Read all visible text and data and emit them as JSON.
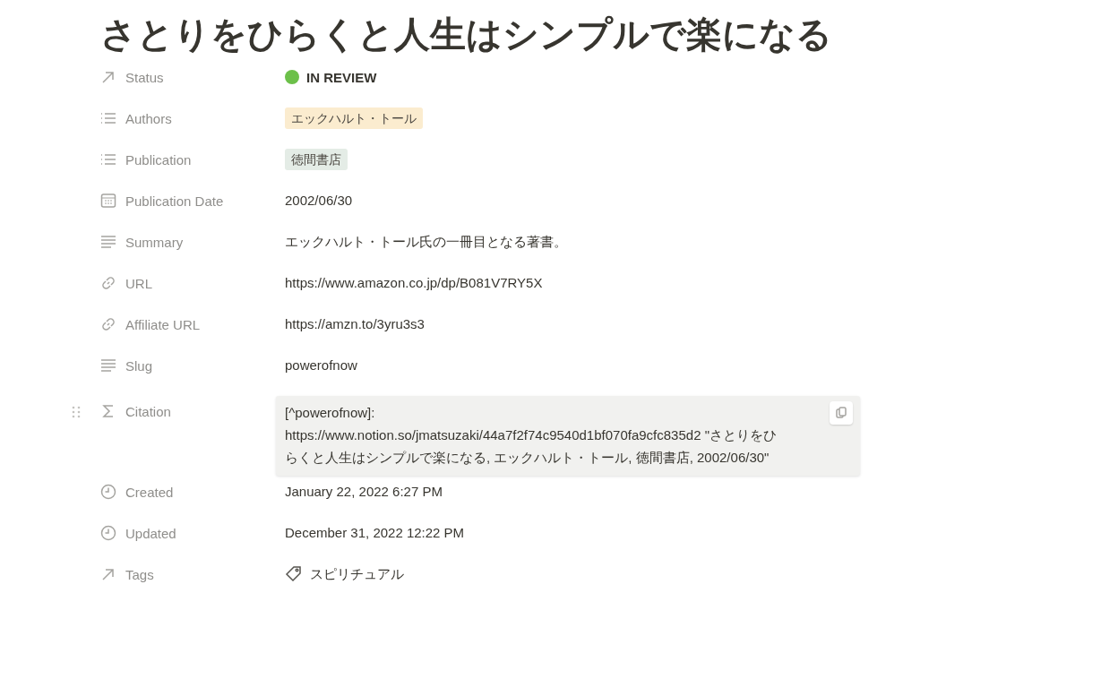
{
  "title": "さとりをひらくと人生はシンプルで楽になる",
  "properties": [
    {
      "kind": "status",
      "label": "Status",
      "value": "IN REVIEW",
      "color": "#6cc04a"
    },
    {
      "kind": "multi_select",
      "label": "Authors",
      "tags": [
        {
          "text": "エックハルト・トール",
          "color": "#fbeccf"
        }
      ]
    },
    {
      "kind": "multi_select",
      "label": "Publication",
      "tags": [
        {
          "text": "徳間書店",
          "color": "#e4ece6"
        }
      ]
    },
    {
      "kind": "date",
      "label": "Publication Date",
      "value": "2002/06/30"
    },
    {
      "kind": "text",
      "label": "Summary",
      "value": "エックハルト・トール氏の一冊目となる著書。"
    },
    {
      "kind": "url",
      "label": "URL",
      "value": "https://www.amazon.co.jp/dp/B081V7RY5X"
    },
    {
      "kind": "url",
      "label": "Affiliate URL",
      "value": "https://amzn.to/3yru3s3"
    },
    {
      "kind": "text",
      "label": "Slug",
      "value": "powerofnow"
    },
    {
      "kind": "formula",
      "label": "Citation",
      "hovered": true,
      "lines": [
        "[^powerofnow]:",
        "https://www.notion.so/jmatsuzaki/44a7f2f74c9540d1bf070fa9cfc835d2 \"さとりをひ",
        "らくと人生はシンプルで楽になる, エックハルト・トール, 徳間書店, 2002/06/30\""
      ]
    },
    {
      "kind": "created_time",
      "label": "Created",
      "value": "January 22, 2022 6:27 PM"
    },
    {
      "kind": "created_time",
      "label": "Updated",
      "value": "December 31, 2022 12:22 PM"
    },
    {
      "kind": "relation",
      "label": "Tags",
      "value": "スピリチュアル"
    }
  ]
}
